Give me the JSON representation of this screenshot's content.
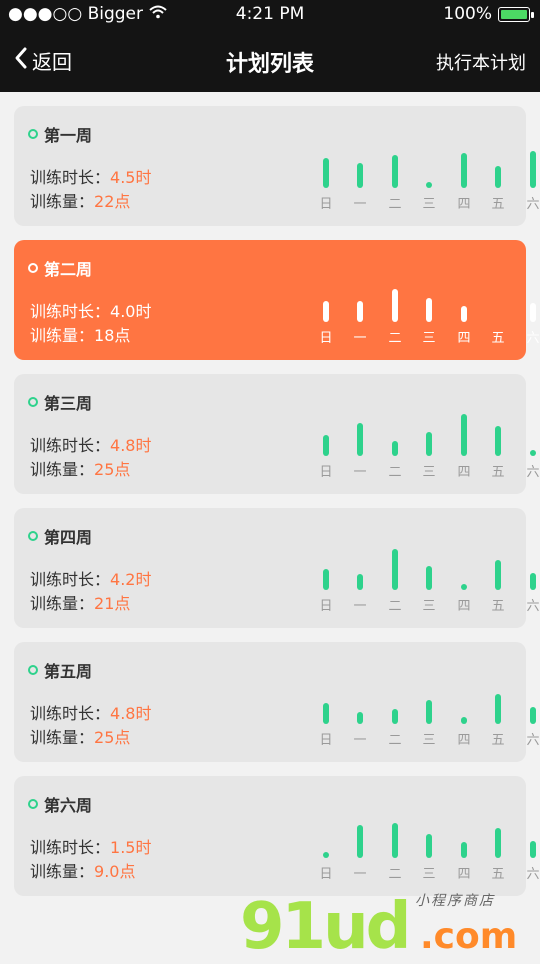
{
  "status": {
    "carrier": "●●●○○ Bigger",
    "time": "4:21 PM",
    "battery": "100%"
  },
  "nav": {
    "back_label": "返回",
    "title": "计划列表",
    "action_label": "执行本计划"
  },
  "days": [
    "日",
    "一",
    "二",
    "三",
    "四",
    "五",
    "六"
  ],
  "duration_label": "训练时长：",
  "points_label": "训练量：",
  "weeks": [
    {
      "title": "第一周",
      "duration": "4.5时",
      "points": "22点",
      "active": false,
      "levels": [
        0.48,
        0.4,
        0.54,
        0.08,
        0.56,
        0.36,
        0.6
      ]
    },
    {
      "title": "第二周",
      "duration": "4.0时",
      "points": "18点",
      "active": true,
      "levels": [
        0.34,
        0.34,
        0.54,
        0.38,
        0.26,
        0.0,
        0.3
      ]
    },
    {
      "title": "第三周",
      "duration": "4.8时",
      "points": "25点",
      "active": false,
      "levels": [
        0.34,
        0.54,
        0.24,
        0.38,
        0.68,
        0.48,
        0.04
      ]
    },
    {
      "title": "第四周",
      "duration": "4.2时",
      "points": "21点",
      "active": false,
      "levels": [
        0.34,
        0.26,
        0.66,
        0.38,
        0.08,
        0.48,
        0.28
      ]
    },
    {
      "title": "第五周",
      "duration": "4.8时",
      "points": "25点",
      "active": false,
      "levels": [
        0.34,
        0.2,
        0.24,
        0.38,
        0.12,
        0.48,
        0.28
      ]
    },
    {
      "title": "第六周",
      "duration": "1.5时",
      "points": "9.0点",
      "active": false,
      "levels": [
        0.06,
        0.54,
        0.56,
        0.38,
        0.26,
        0.48,
        0.28
      ]
    }
  ],
  "watermark": {
    "logo": "91ud",
    "domain": ".com",
    "tagline": "小程序商店"
  },
  "colors": {
    "accent": "#ff7542",
    "bar": "#2ed28c",
    "card": "#e6e6e6",
    "nav": "#141414"
  }
}
